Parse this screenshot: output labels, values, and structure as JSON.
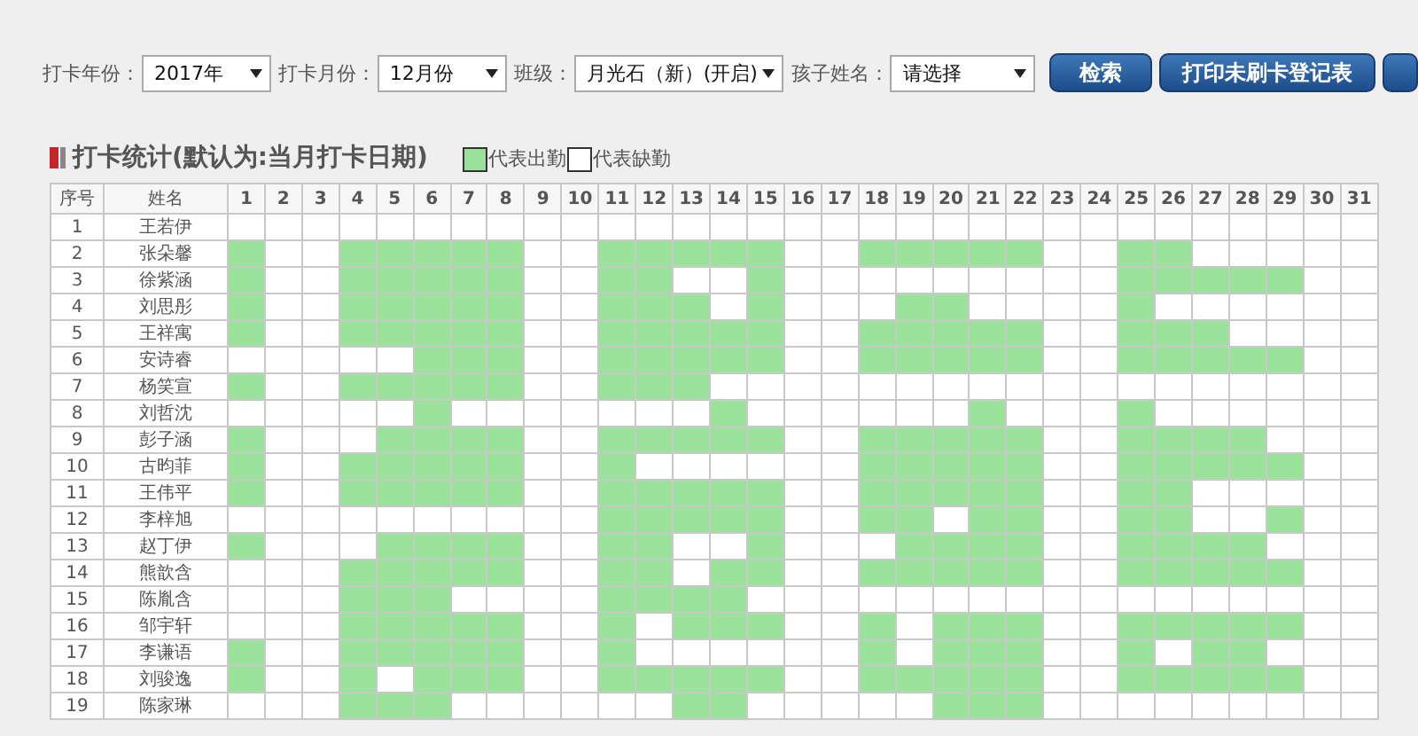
{
  "filters": [
    {
      "label": "打卡年份：",
      "value": "2017年"
    },
    {
      "label": "打卡月份：",
      "value": "12月份"
    },
    {
      "label": "班级：",
      "value": "月光石（新）(开启)"
    },
    {
      "label": "孩子姓名：",
      "value": "请选择"
    }
  ],
  "buttons": [
    {
      "kind": "text",
      "label": "检索"
    },
    {
      "kind": "text",
      "label": "打印未刷卡登记表"
    },
    {
      "kind": "clipped"
    }
  ],
  "section": {
    "title": "打卡统计(默认为:当月打卡日期)",
    "legend": [
      {
        "label": "代表出勤",
        "present": true
      },
      {
        "label": "代表缺勤",
        "present": false
      }
    ]
  },
  "table": {
    "columns": [
      "序号",
      "姓名",
      "1",
      "2",
      "3",
      "4",
      "5",
      "6",
      "7",
      "8",
      "9",
      "10",
      "11",
      "12",
      "13",
      "14",
      "15",
      "16",
      "17",
      "18",
      "19",
      "20",
      "21",
      "22",
      "23",
      "24",
      "25",
      "26",
      "27",
      "28",
      "29",
      "30",
      "31"
    ],
    "rows": [
      {
        "index": "1",
        "name": "王若伊",
        "present": [
          false,
          false,
          false,
          false,
          false,
          false,
          false,
          false,
          false,
          false,
          false,
          false,
          false,
          false,
          false,
          false,
          false,
          false,
          false,
          false,
          false,
          false,
          false,
          false,
          false,
          false,
          false,
          false,
          false,
          false,
          false
        ]
      },
      {
        "index": "2",
        "name": "张朵馨",
        "present": [
          true,
          false,
          false,
          true,
          true,
          true,
          true,
          true,
          false,
          false,
          true,
          true,
          true,
          true,
          true,
          false,
          false,
          true,
          true,
          true,
          true,
          true,
          false,
          false,
          true,
          true,
          false,
          false,
          false,
          false,
          false
        ]
      },
      {
        "index": "3",
        "name": "徐紫涵",
        "present": [
          true,
          false,
          false,
          true,
          true,
          true,
          true,
          true,
          false,
          false,
          true,
          true,
          false,
          false,
          true,
          false,
          false,
          false,
          false,
          false,
          false,
          false,
          false,
          false,
          true,
          true,
          true,
          true,
          true,
          false,
          false
        ]
      },
      {
        "index": "4",
        "name": "刘思彤",
        "present": [
          true,
          false,
          false,
          true,
          true,
          true,
          true,
          true,
          false,
          false,
          true,
          true,
          true,
          false,
          true,
          false,
          false,
          false,
          true,
          true,
          false,
          false,
          false,
          false,
          true,
          false,
          false,
          false,
          false,
          false,
          false
        ]
      },
      {
        "index": "5",
        "name": "王祥寓",
        "present": [
          true,
          false,
          false,
          true,
          true,
          true,
          true,
          true,
          false,
          false,
          true,
          true,
          true,
          true,
          true,
          false,
          false,
          true,
          true,
          true,
          true,
          true,
          false,
          false,
          true,
          true,
          true,
          false,
          false,
          false,
          false
        ]
      },
      {
        "index": "6",
        "name": "安诗睿",
        "present": [
          false,
          false,
          false,
          false,
          false,
          true,
          true,
          true,
          false,
          false,
          true,
          true,
          true,
          true,
          true,
          false,
          false,
          true,
          true,
          true,
          true,
          true,
          false,
          false,
          true,
          true,
          true,
          true,
          true,
          false,
          false
        ]
      },
      {
        "index": "7",
        "name": "杨笑宣",
        "present": [
          true,
          false,
          false,
          true,
          true,
          true,
          true,
          true,
          false,
          false,
          true,
          true,
          true,
          false,
          false,
          false,
          false,
          false,
          false,
          false,
          false,
          false,
          false,
          false,
          false,
          false,
          false,
          false,
          false,
          false,
          false
        ]
      },
      {
        "index": "8",
        "name": "刘哲沈",
        "present": [
          false,
          false,
          false,
          false,
          false,
          true,
          false,
          false,
          false,
          false,
          false,
          false,
          false,
          true,
          false,
          false,
          false,
          false,
          false,
          false,
          true,
          false,
          false,
          false,
          true,
          false,
          false,
          false,
          false,
          false,
          false
        ]
      },
      {
        "index": "9",
        "name": "彭子涵",
        "present": [
          true,
          false,
          false,
          false,
          true,
          true,
          true,
          true,
          false,
          false,
          true,
          true,
          true,
          true,
          true,
          false,
          false,
          true,
          true,
          true,
          true,
          true,
          false,
          false,
          true,
          true,
          true,
          true,
          false,
          false,
          false
        ]
      },
      {
        "index": "10",
        "name": "古昀菲",
        "present": [
          true,
          false,
          false,
          true,
          true,
          true,
          true,
          true,
          false,
          false,
          true,
          false,
          false,
          false,
          false,
          false,
          false,
          true,
          true,
          true,
          true,
          true,
          false,
          false,
          true,
          true,
          true,
          true,
          true,
          false,
          false
        ]
      },
      {
        "index": "11",
        "name": "王伟平",
        "present": [
          true,
          false,
          false,
          true,
          true,
          true,
          true,
          true,
          false,
          false,
          true,
          true,
          true,
          true,
          true,
          false,
          false,
          true,
          true,
          true,
          true,
          true,
          false,
          false,
          true,
          true,
          false,
          false,
          false,
          false,
          false
        ]
      },
      {
        "index": "12",
        "name": "李梓旭",
        "present": [
          false,
          false,
          false,
          false,
          false,
          false,
          false,
          false,
          false,
          false,
          true,
          true,
          true,
          true,
          true,
          false,
          false,
          true,
          true,
          false,
          true,
          true,
          false,
          false,
          true,
          true,
          false,
          false,
          true,
          false,
          false
        ]
      },
      {
        "index": "13",
        "name": "赵丁伊",
        "present": [
          true,
          false,
          false,
          false,
          true,
          true,
          true,
          true,
          false,
          false,
          true,
          true,
          false,
          false,
          true,
          false,
          false,
          false,
          true,
          true,
          true,
          true,
          false,
          false,
          true,
          true,
          true,
          true,
          false,
          false,
          false
        ]
      },
      {
        "index": "14",
        "name": "熊歆含",
        "present": [
          false,
          false,
          false,
          true,
          true,
          true,
          true,
          true,
          false,
          false,
          true,
          true,
          false,
          true,
          true,
          false,
          false,
          true,
          true,
          true,
          true,
          true,
          false,
          false,
          true,
          true,
          true,
          true,
          true,
          false,
          false
        ]
      },
      {
        "index": "15",
        "name": "陈胤含",
        "present": [
          false,
          false,
          false,
          true,
          true,
          true,
          false,
          false,
          false,
          false,
          true,
          true,
          true,
          true,
          false,
          false,
          false,
          false,
          false,
          false,
          false,
          false,
          false,
          false,
          false,
          false,
          false,
          false,
          false,
          false,
          false
        ]
      },
      {
        "index": "16",
        "name": "邹宇轩",
        "present": [
          false,
          false,
          false,
          true,
          true,
          true,
          true,
          true,
          false,
          false,
          true,
          false,
          true,
          true,
          true,
          false,
          false,
          true,
          false,
          true,
          true,
          true,
          false,
          false,
          true,
          true,
          true,
          true,
          true,
          false,
          false
        ]
      },
      {
        "index": "17",
        "name": "李谦语",
        "present": [
          true,
          false,
          false,
          true,
          true,
          true,
          true,
          true,
          false,
          false,
          true,
          false,
          false,
          false,
          false,
          false,
          false,
          true,
          false,
          true,
          true,
          true,
          false,
          false,
          true,
          false,
          true,
          true,
          false,
          false,
          false
        ]
      },
      {
        "index": "18",
        "name": "刘骏逸",
        "present": [
          true,
          false,
          false,
          true,
          false,
          true,
          true,
          true,
          false,
          false,
          true,
          true,
          true,
          true,
          true,
          false,
          false,
          true,
          true,
          true,
          true,
          true,
          false,
          false,
          true,
          true,
          true,
          true,
          true,
          false,
          false
        ]
      },
      {
        "index": "19",
        "name": "陈家琳",
        "present": [
          false,
          false,
          false,
          true,
          true,
          true,
          false,
          false,
          false,
          false,
          false,
          false,
          true,
          true,
          false,
          false,
          false,
          false,
          false,
          true,
          true,
          true,
          false,
          false,
          false,
          false,
          false,
          false,
          false,
          false,
          false
        ]
      }
    ]
  }
}
